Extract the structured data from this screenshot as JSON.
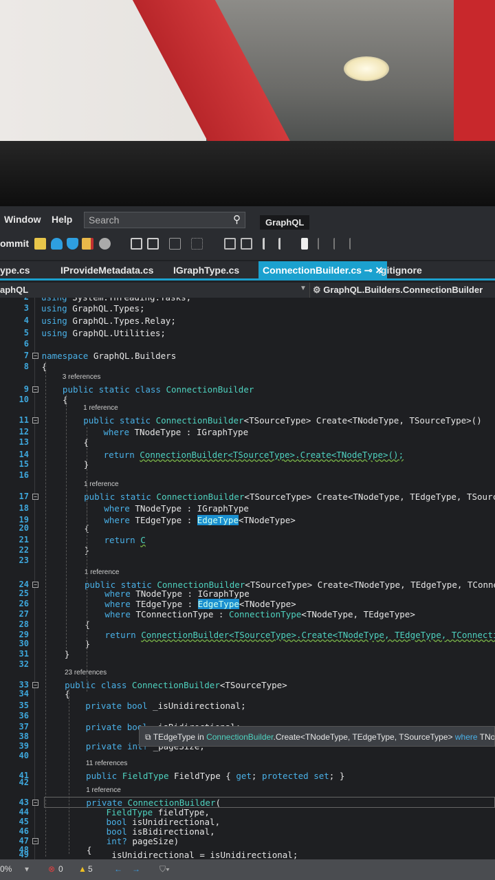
{
  "menu": {
    "items": [
      "Window",
      "Help"
    ],
    "search_placeholder": "Search",
    "project": "GraphQL"
  },
  "toolbar": {
    "commit_label": "ommit"
  },
  "tabs": [
    {
      "label": "ype.cs"
    },
    {
      "label": "IProvideMetadata.cs"
    },
    {
      "label": "IGraphType.cs"
    },
    {
      "label": "ConnectionBuilder.cs",
      "active": true,
      "pin": "⊸",
      "close": "✕"
    },
    {
      "label": ".gitignore"
    }
  ],
  "navbar": {
    "left": "aphQL",
    "right": "GraphQL.Builders.ConnectionBuilder"
  },
  "lenses": [
    {
      "text": "3 references",
      "before": 9
    },
    {
      "text": "1 reference",
      "before": 11
    },
    {
      "text": "1 reference",
      "before": 17
    },
    {
      "text": "1 reference",
      "before": 24
    },
    {
      "text": "23 references",
      "before": 33
    },
    {
      "text": "11 references",
      "before": 41
    },
    {
      "text": "1 reference",
      "before": 43
    }
  ],
  "code": [
    {
      "n": 2,
      "i": 0,
      "t": [
        [
          "kw",
          "using "
        ],
        [
          "tx",
          "System.Threading.Tasks;"
        ]
      ]
    },
    {
      "n": 3,
      "i": 0,
      "t": [
        [
          "kw",
          "using "
        ],
        [
          "tx",
          "GraphQL.Types;"
        ]
      ]
    },
    {
      "n": 4,
      "i": 0,
      "t": [
        [
          "kw",
          "using "
        ],
        [
          "tx",
          "GraphQL.Types.Relay;"
        ]
      ]
    },
    {
      "n": 5,
      "i": 0,
      "t": [
        [
          "kw",
          "using "
        ],
        [
          "tx",
          "GraphQL.Utilities;"
        ]
      ]
    },
    {
      "n": 6,
      "i": 0,
      "t": []
    },
    {
      "n": 7,
      "i": 0,
      "t": [
        [
          "kw",
          "namespace "
        ],
        [
          "tx",
          "GraphQL.Builders"
        ]
      ]
    },
    {
      "n": 8,
      "i": 0,
      "t": [
        [
          "tx",
          "{"
        ]
      ]
    },
    {
      "n": 9,
      "i": 1,
      "t": [
        [
          "kw",
          "public static class "
        ],
        [
          "ty",
          "ConnectionBuilder"
        ]
      ]
    },
    {
      "n": 10,
      "i": 1,
      "t": [
        [
          "tx",
          "{"
        ]
      ]
    },
    {
      "n": 11,
      "i": 2,
      "t": [
        [
          "kw",
          "public static "
        ],
        [
          "ty",
          "ConnectionBuilder"
        ],
        [
          "tx",
          "<TSourceType> Create<TNodeType, TSourceType>()"
        ]
      ]
    },
    {
      "n": 12,
      "i": 3,
      "t": [
        [
          "kw",
          "where "
        ],
        [
          "tx",
          "TNodeType : "
        ],
        [
          "tx",
          "IGraphType"
        ]
      ]
    },
    {
      "n": 13,
      "i": 2,
      "t": [
        [
          "tx",
          "{"
        ]
      ]
    },
    {
      "n": 14,
      "i": 3,
      "t": [
        [
          "kw",
          "return "
        ],
        [
          "sq",
          "ConnectionBuilder<TSourceType>.Create<TNodeType>();"
        ]
      ]
    },
    {
      "n": 15,
      "i": 2,
      "t": [
        [
          "tx",
          "}"
        ]
      ]
    },
    {
      "n": 16,
      "i": 0,
      "t": []
    },
    {
      "n": 17,
      "i": 2,
      "t": [
        [
          "kw",
          "public static "
        ],
        [
          "ty",
          "ConnectionBuilder"
        ],
        [
          "tx",
          "<TSourceType> Create<TNodeType, TEdgeType, TSourceType>"
        ]
      ]
    },
    {
      "n": 18,
      "i": 3,
      "t": [
        [
          "kw",
          "where "
        ],
        [
          "tx",
          "TNodeType : IGraphType"
        ]
      ]
    },
    {
      "n": 19,
      "i": 3,
      "t": [
        [
          "kw",
          "where "
        ],
        [
          "tx",
          "TEdgeType : "
        ],
        [
          "hl",
          "EdgeType"
        ],
        [
          "tx",
          "<TNodeType>"
        ]
      ]
    },
    {
      "n": 20,
      "i": 2,
      "t": [
        [
          "tx",
          "{"
        ]
      ]
    },
    {
      "n": 21,
      "i": 3,
      "t": [
        [
          "kw",
          "return "
        ],
        [
          "sq",
          "C"
        ]
      ]
    },
    {
      "n": 22,
      "i": 2,
      "t": [
        [
          "tx",
          "}"
        ]
      ]
    },
    {
      "n": 23,
      "i": 0,
      "t": []
    },
    {
      "n": 24,
      "i": 2,
      "t": [
        [
          "kw",
          "public static "
        ],
        [
          "ty",
          "ConnectionBuilder"
        ],
        [
          "tx",
          "<TSourceType> Create<TNodeType, TEdgeType, TConnectionType"
        ]
      ]
    },
    {
      "n": 25,
      "i": 3,
      "t": [
        [
          "kw",
          "where "
        ],
        [
          "tx",
          "TNodeType : IGraphType"
        ]
      ]
    },
    {
      "n": 26,
      "i": 3,
      "t": [
        [
          "kw",
          "where "
        ],
        [
          "tx",
          "TEdgeType : "
        ],
        [
          "hl",
          "EdgeType"
        ],
        [
          "tx",
          "<TNodeType>"
        ]
      ]
    },
    {
      "n": 27,
      "i": 3,
      "t": [
        [
          "kw",
          "where "
        ],
        [
          "tx",
          "TConnectionType : "
        ],
        [
          "ty",
          "ConnectionType"
        ],
        [
          "tx",
          "<TNodeType, TEdgeType>"
        ]
      ]
    },
    {
      "n": 28,
      "i": 2,
      "t": [
        [
          "tx",
          "{"
        ]
      ]
    },
    {
      "n": 29,
      "i": 3,
      "t": [
        [
          "kw",
          "return "
        ],
        [
          "sq",
          "ConnectionBuilder<TSourceType>.Create<TNodeType, TEdgeType, TConnectionType"
        ]
      ]
    },
    {
      "n": 30,
      "i": 2,
      "t": [
        [
          "tx",
          "}"
        ]
      ]
    },
    {
      "n": 31,
      "i": 1,
      "t": [
        [
          "tx",
          "}"
        ]
      ]
    },
    {
      "n": 32,
      "i": 0,
      "t": []
    },
    {
      "n": 33,
      "i": 1,
      "t": [
        [
          "kw",
          "public class "
        ],
        [
          "ty",
          "ConnectionBuilder"
        ],
        [
          "tx",
          "<TSourceType>"
        ]
      ]
    },
    {
      "n": 34,
      "i": 1,
      "t": [
        [
          "tx",
          "{"
        ]
      ]
    },
    {
      "n": 35,
      "i": 2,
      "t": [
        [
          "kw",
          "private bool "
        ],
        [
          "tx",
          "_isUnidirectional;"
        ]
      ]
    },
    {
      "n": 36,
      "i": 0,
      "t": []
    },
    {
      "n": 37,
      "i": 2,
      "t": [
        [
          "kw",
          "private bool "
        ],
        [
          "tx",
          "_isBidirectional;"
        ]
      ]
    },
    {
      "n": 38,
      "i": 0,
      "t": []
    },
    {
      "n": 39,
      "i": 2,
      "t": [
        [
          "kw",
          "private int? "
        ],
        [
          "tx",
          "_pageSize;"
        ]
      ]
    },
    {
      "n": 40,
      "i": 0,
      "t": []
    },
    {
      "n": 41,
      "i": 2,
      "t": [
        [
          "kw",
          "public "
        ],
        [
          "ty",
          "FieldType "
        ],
        [
          "tx",
          "FieldType { "
        ],
        [
          "kw",
          "get"
        ],
        [
          "tx",
          "; "
        ],
        [
          "kw",
          "protected set"
        ],
        [
          "tx",
          "; }"
        ]
      ]
    },
    {
      "n": 42,
      "i": 0,
      "t": []
    },
    {
      "n": 43,
      "i": 2,
      "t": [
        [
          "kw",
          "private "
        ],
        [
          "ty",
          "ConnectionBuilder"
        ],
        [
          "tx",
          "("
        ]
      ]
    },
    {
      "n": 44,
      "i": 3,
      "t": [
        [
          "ty",
          "FieldType "
        ],
        [
          "tx",
          "fieldType,"
        ]
      ]
    },
    {
      "n": 45,
      "i": 3,
      "t": [
        [
          "kw",
          "bool "
        ],
        [
          "tx",
          "isUnidirectional,"
        ]
      ]
    },
    {
      "n": 46,
      "i": 3,
      "t": [
        [
          "kw",
          "bool "
        ],
        [
          "tx",
          "isBidirectional,"
        ]
      ]
    },
    {
      "n": 47,
      "i": 3,
      "t": [
        [
          "kw",
          "int? "
        ],
        [
          "tx",
          "pageSize)"
        ]
      ]
    },
    {
      "n": 48,
      "i": 2,
      "t": [
        [
          "tx",
          "{"
        ]
      ]
    },
    {
      "n": 49,
      "i": 3,
      "t": [
        [
          "tx",
          "_isUnidirectional = isUnidirectional;"
        ]
      ]
    }
  ],
  "tooltip": {
    "name": "TEdgeType",
    "in": " in ",
    "owner": "ConnectionBuilder",
    "sig": ".Create<TNodeType, TEdgeType, TSourceType> ",
    "where": "where",
    "rest": " TNodeType"
  },
  "status": {
    "zoom": "0%",
    "errors": "0",
    "warnings": "5"
  },
  "colors": {
    "accent": "#1ba1cf",
    "keyword": "#4ab1e8",
    "type": "#4fd3c0"
  }
}
